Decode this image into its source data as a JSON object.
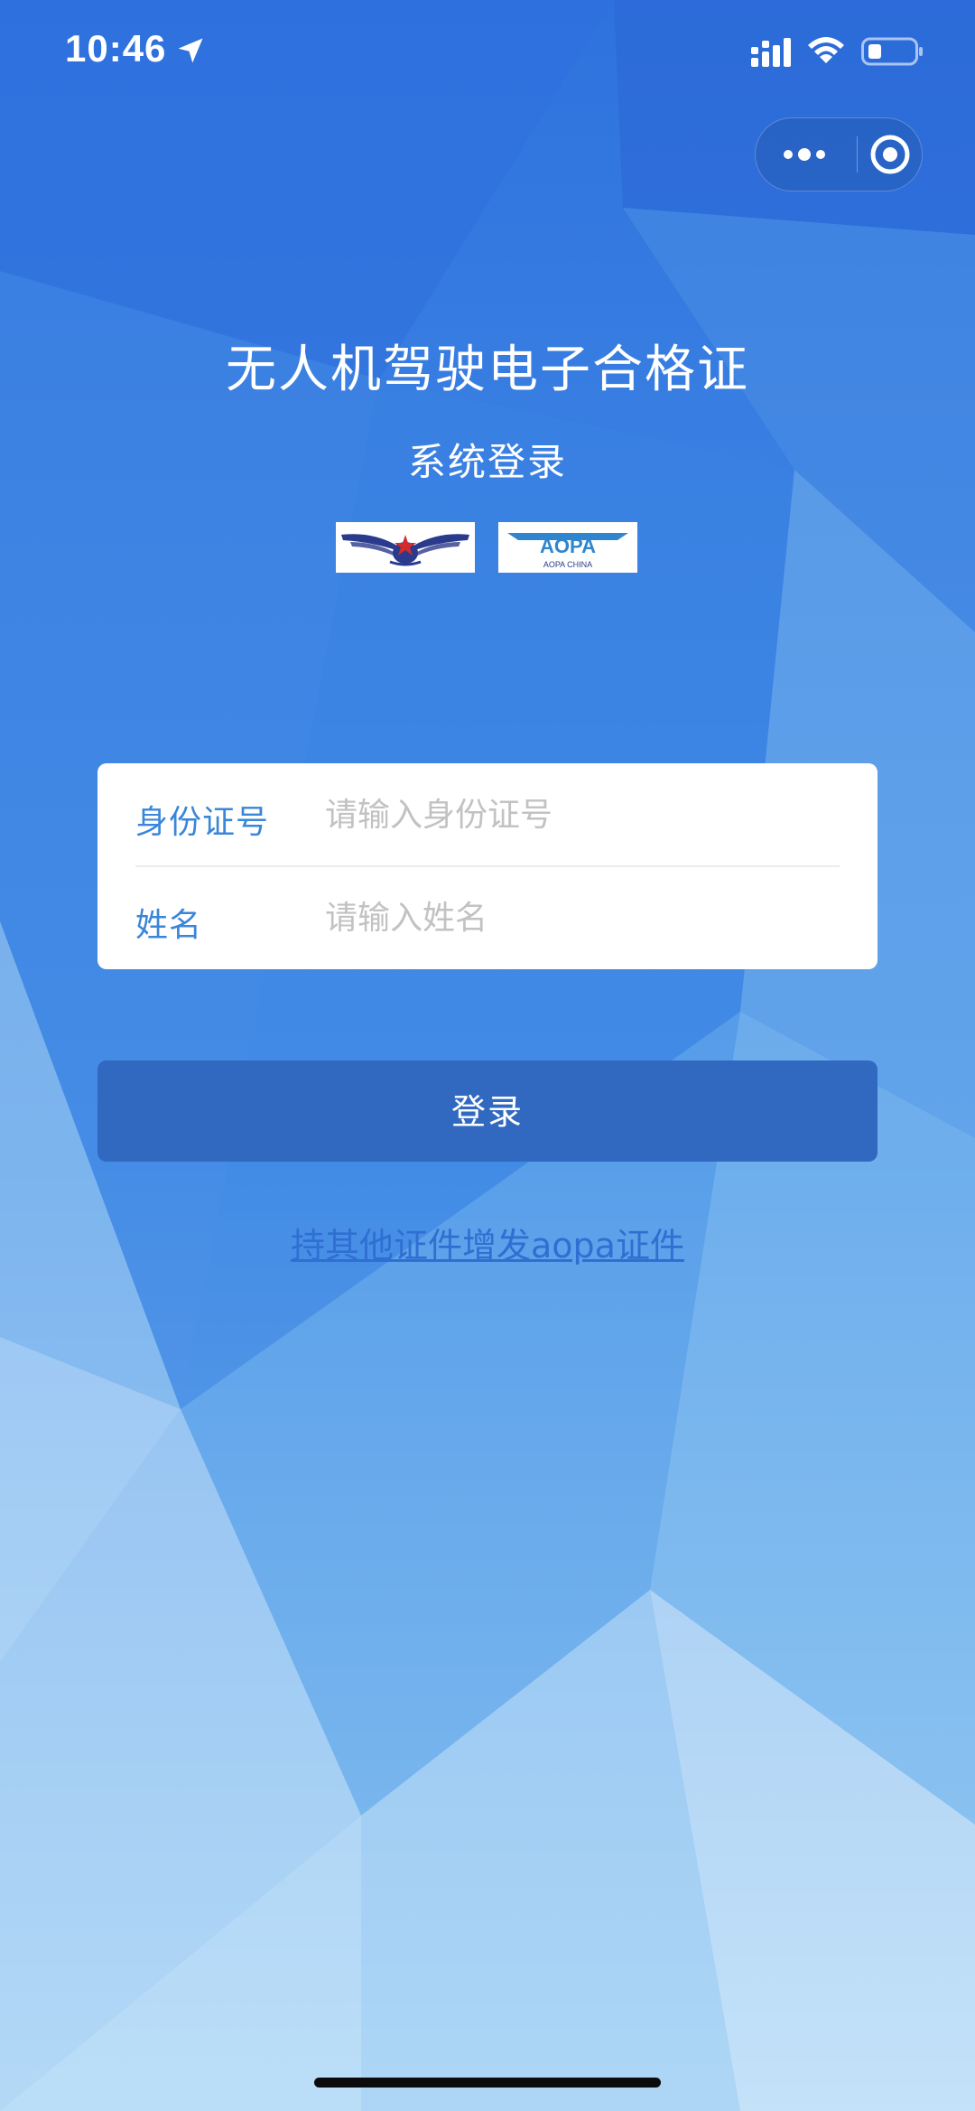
{
  "status_bar": {
    "time": "10:46",
    "icons": [
      "location-arrow-icon",
      "cellular-signal-icon",
      "wifi-icon",
      "battery-icon"
    ]
  },
  "capsule": {
    "more_icon": "more-dots-icon",
    "close_icon": "target-close-icon"
  },
  "header": {
    "title": "无人机驾驶电子合格证",
    "subtitle": "系统登录"
  },
  "logos": {
    "caac": "caac-wings-logo",
    "aopa": {
      "icon": "aopa-logo",
      "text": "AOPA",
      "subtext": "AOPA CHINA"
    }
  },
  "form": {
    "id_label": "身份证号",
    "id_value": "",
    "id_placeholder": "请输入身份证号",
    "name_label": "姓名",
    "name_value": "",
    "name_placeholder": "请输入姓名"
  },
  "login_button": "登录",
  "alt_link": "持其他证件增发aopa证件",
  "colors": {
    "background": "#3d86e4",
    "label": "#3a86d8",
    "button": "#3269c0",
    "link": "#2f6fd2"
  }
}
